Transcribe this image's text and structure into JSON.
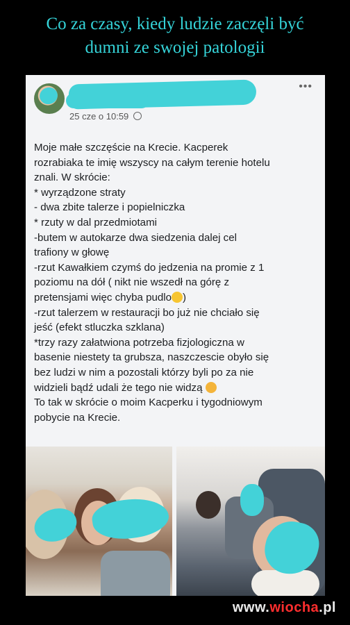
{
  "headline": {
    "line1": "Co za czasy, kiedy ludzie zaczęli być",
    "line2": "dumni ze swojej patologii"
  },
  "post": {
    "menu_glyph": "•••",
    "timestamp": "25 cze o 10:59",
    "lines": [
      "Moje małe szczęście na Krecie. Kacperek",
      "rozrabiaka te imię wszyscy na całym terenie hotelu",
      "znali. W skrócie:",
      "* wyrządzone straty",
      "- dwa zbite talerze i popielniczka",
      "* rzuty w dal przedmiotami",
      "-butem w autokarze dwa siedzenia dalej cel",
      "trafiony w głowę",
      "-rzut Kawałkiem czymś do jedzenia na promie z 1",
      "poziomu na dół ( nikt nie wszedł na górę z",
      "pretensjami więc chyba pudlo",
      "-rzut talerzem w restauracji bo już nie chciało się",
      "jeść (efekt stluczka szklana)",
      "*trzy razy załatwiona potrzeba fizjologiczna w",
      "basenie niestety ta grubsza, naszczescie  obyło się",
      "bez ludzi w nim a pozostali którzy byli po za nie",
      "widzieli bądź udali że tego nie widzą",
      "To tak w skrócie o moim Kacperku i tygodniowym",
      "pobycie na Krecie."
    ],
    "line10_suffix": ")"
  },
  "watermark": {
    "pre": "www.",
    "brand": "wiocha",
    "post": ".pl"
  }
}
